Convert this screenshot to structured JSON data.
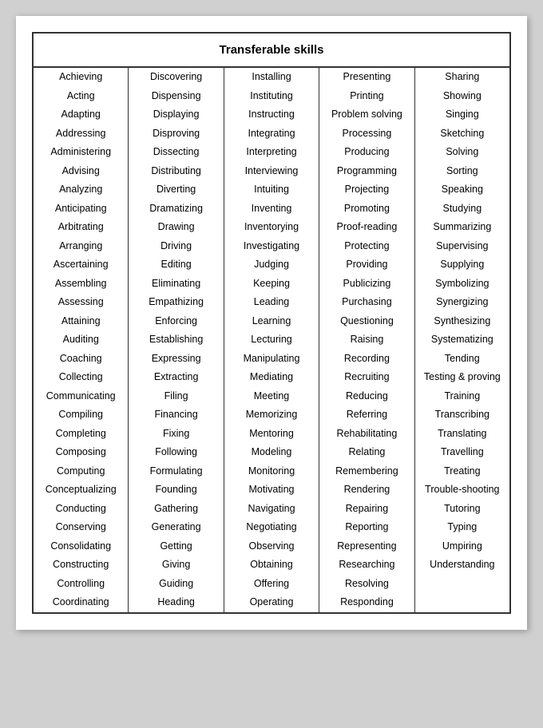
{
  "title": "Transferable skills",
  "columns": [
    {
      "id": "col1",
      "items": [
        "Achieving",
        "Acting",
        "Adapting",
        "Addressing",
        "Administering",
        "Advising",
        "Analyzing",
        "Anticipating",
        "Arbitrating",
        "Arranging",
        "Ascertaining",
        "Assembling",
        "Assessing",
        "Attaining",
        "Auditing",
        "Coaching",
        "Collecting",
        "Communicating",
        "Compiling",
        "Completing",
        "Composing",
        "Computing",
        "Conceptualizing",
        "Conducting",
        "Conserving",
        "Consolidating",
        "Constructing",
        "Controlling",
        "Coordinating"
      ]
    },
    {
      "id": "col2",
      "items": [
        "Discovering",
        "Dispensing",
        "Displaying",
        "Disproving",
        "Dissecting",
        "Distributing",
        "Diverting",
        "Dramatizing",
        "Drawing",
        "Driving",
        "Editing",
        "Eliminating",
        "Empathizing",
        "Enforcing",
        "Establishing",
        "Expressing",
        "Extracting",
        "Filing",
        "Financing",
        "Fixing",
        "Following",
        "Formulating",
        "Founding",
        "Gathering",
        "Generating",
        "Getting",
        "Giving",
        "Guiding",
        "Heading"
      ]
    },
    {
      "id": "col3",
      "items": [
        "Installing",
        "Instituting",
        "Instructing",
        "Integrating",
        "Interpreting",
        "Interviewing",
        "Intuiting",
        "Inventing",
        "Inventorying",
        "Investigating",
        "Judging",
        "Keeping",
        "Leading",
        "Learning",
        "Lecturing",
        "Manipulating",
        "Mediating",
        "Meeting",
        "Memorizing",
        "Mentoring",
        "Modeling",
        "Monitoring",
        "Motivating",
        "Navigating",
        "Negotiating",
        "Observing",
        "Obtaining",
        "Offering",
        "Operating"
      ]
    },
    {
      "id": "col4",
      "items": [
        "Presenting",
        "Printing",
        "Problem solving",
        "Processing",
        "Producing",
        "Programming",
        "Projecting",
        "Promoting",
        "Proof-reading",
        "Protecting",
        "Providing",
        "Publicizing",
        "Purchasing",
        "Questioning",
        "Raising",
        "Recording",
        "Recruiting",
        "Reducing",
        "Referring",
        "Rehabilitating",
        "Relating",
        "Remembering",
        "Rendering",
        "Repairing",
        "Reporting",
        "Representing",
        "Researching",
        "Resolving",
        "Responding"
      ]
    },
    {
      "id": "col5",
      "items": [
        "Sharing",
        "Showing",
        "Singing",
        "Sketching",
        "Solving",
        "Sorting",
        "Speaking",
        "Studying",
        "Summarizing",
        "Supervising",
        "Supplying",
        "Symbolizing",
        "Synergizing",
        "Synthesizing",
        "Systematizing",
        "Tending",
        "Testing & proving",
        "Training",
        "Transcribing",
        "Translating",
        "Travelling",
        "Treating",
        "Trouble-shooting",
        "Tutoring",
        "Typing",
        "Umpiring",
        "Understanding",
        "",
        ""
      ]
    }
  ]
}
